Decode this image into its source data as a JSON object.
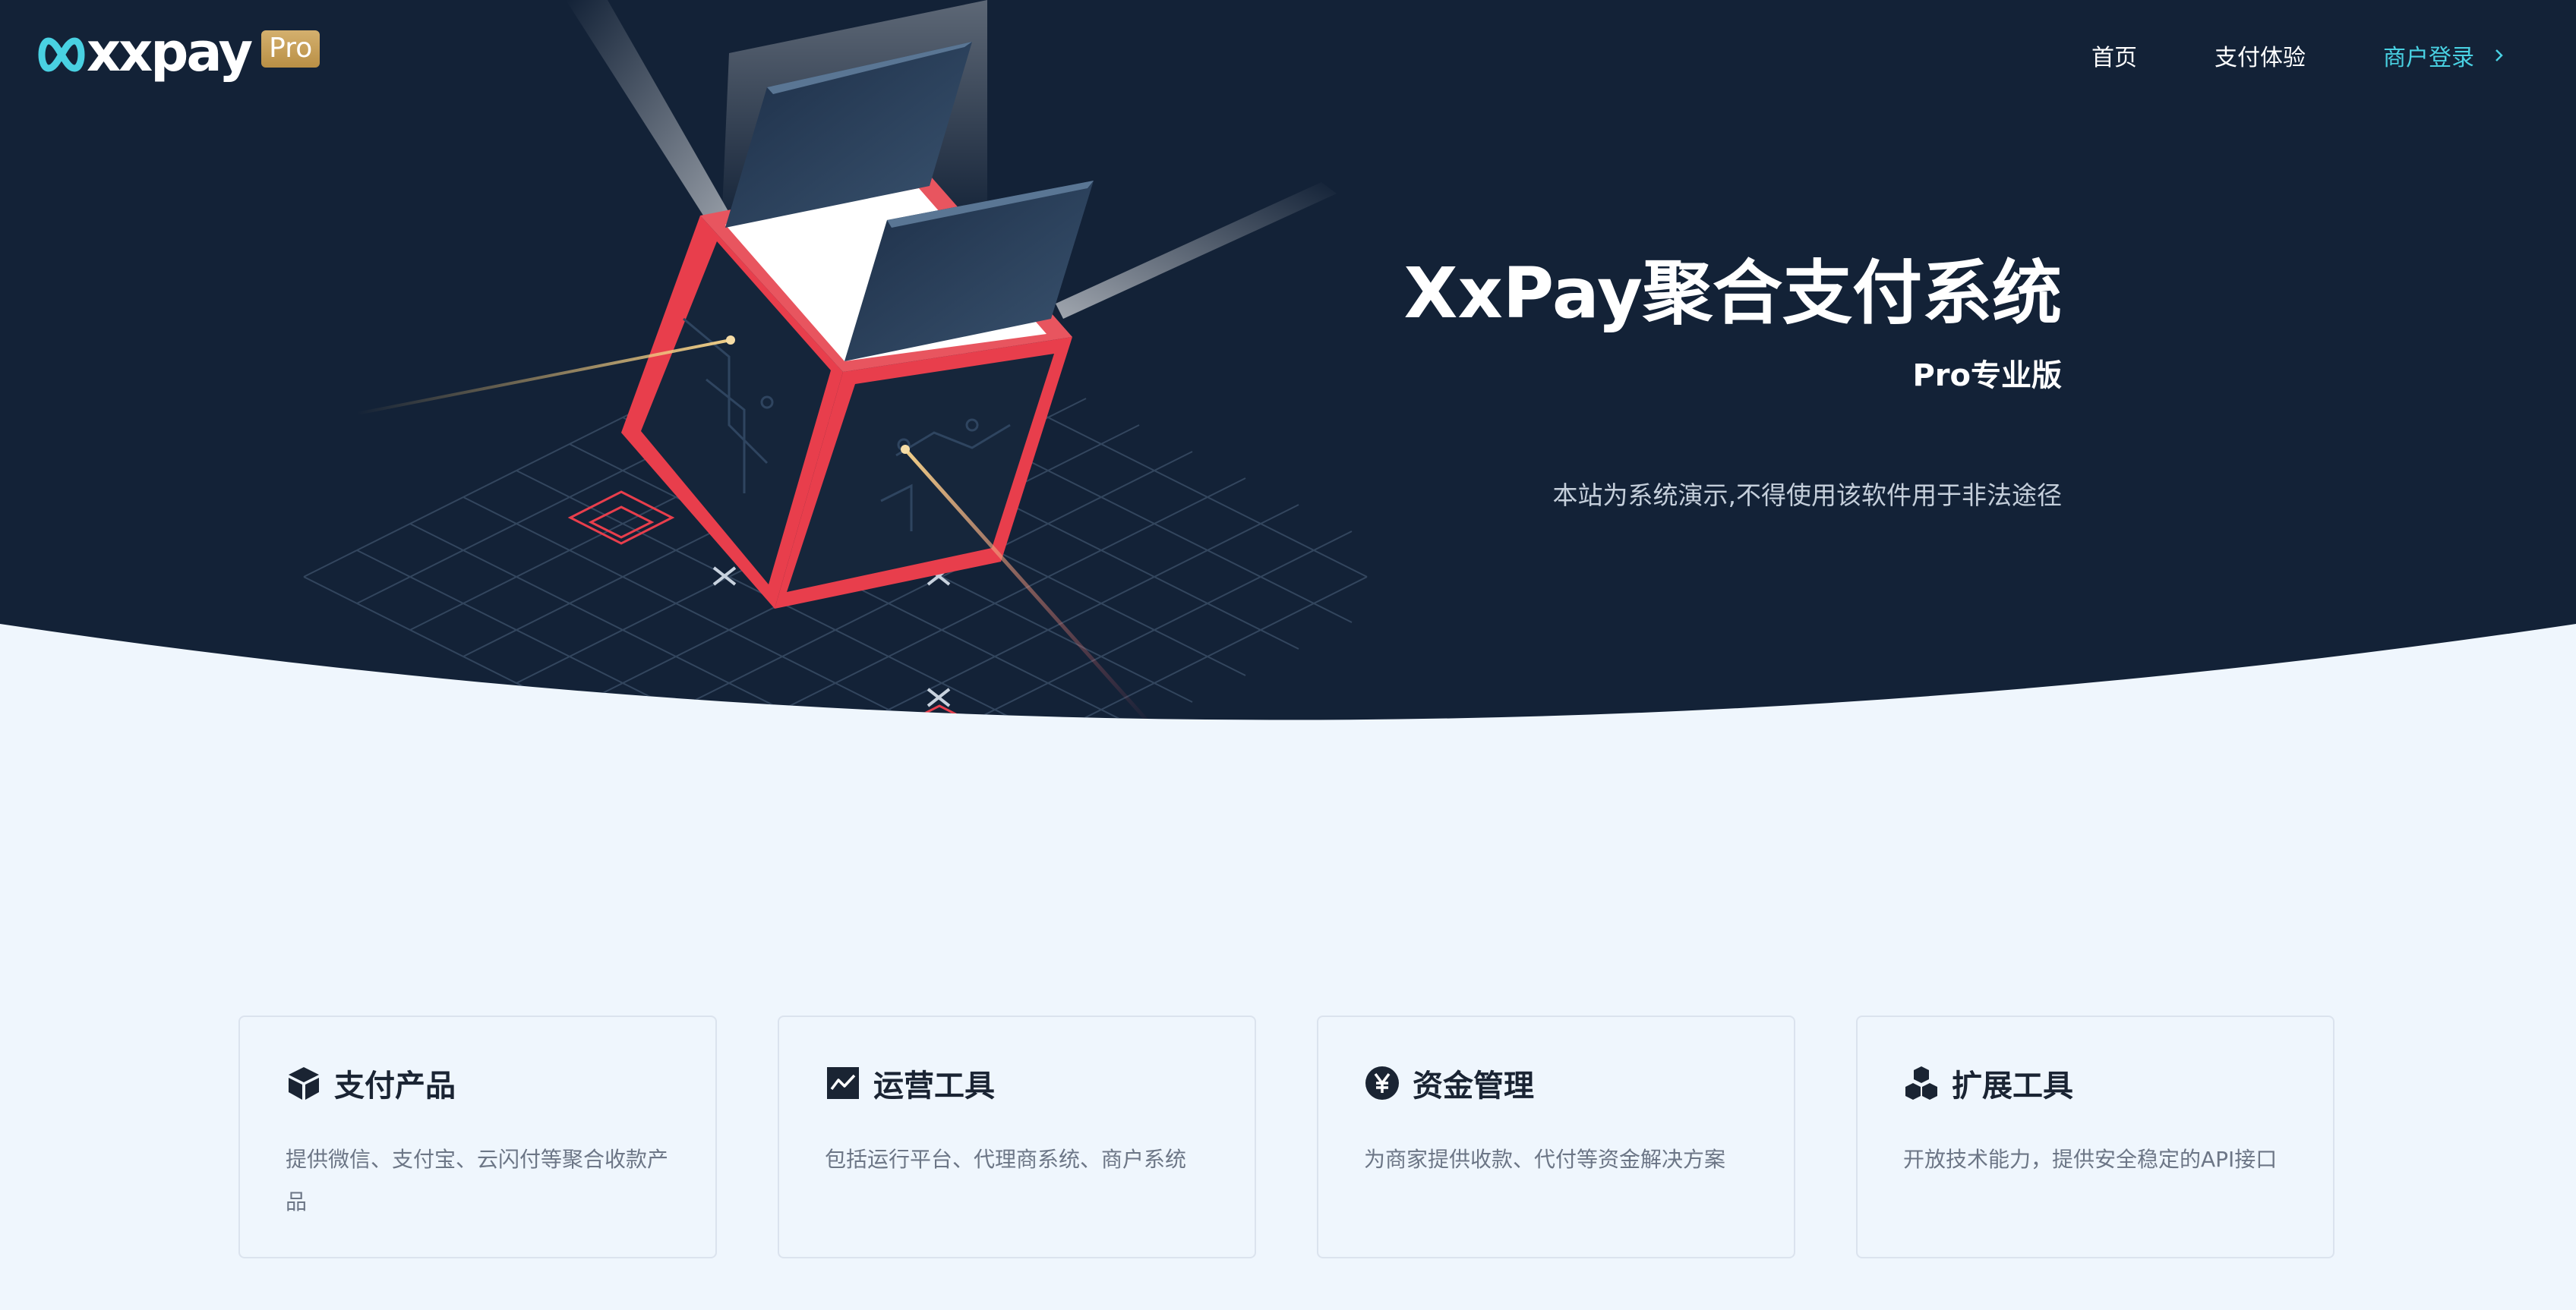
{
  "header": {
    "logo_text": "xxpay",
    "logo_badge": "Pro",
    "nav": [
      {
        "label": "首页",
        "icon": null
      },
      {
        "label": "支付体验",
        "icon": null
      },
      {
        "label": "商户登录",
        "icon": "chevron-right-icon"
      }
    ]
  },
  "hero": {
    "title": "XxPay聚合支付系统",
    "subtitle": "Pro专业版",
    "notice": "本站为系统演示,不得使用该软件用于非法途径"
  },
  "features": [
    {
      "icon": "cube-icon",
      "title": "支付产品",
      "desc": "提供微信、支付宝、云闪付等聚合收款产品"
    },
    {
      "icon": "line-chart-icon",
      "title": "运营工具",
      "desc": "包括运行平台、代理商系统、商户系统"
    },
    {
      "icon": "yuan-circle-icon",
      "title": "资金管理",
      "desc": "为商家提供收款、代付等资金解决方案"
    },
    {
      "icon": "cubes-icon",
      "title": "扩展工具",
      "desc": "开放技术能力，提供安全稳定的API接口"
    }
  ],
  "colors": {
    "hero_bg": "#132237",
    "page_bg": "#eff6fd",
    "accent_red": "#e83e4c",
    "accent_cyan": "#49d1e2",
    "badge_gold": "#c7a25a"
  }
}
